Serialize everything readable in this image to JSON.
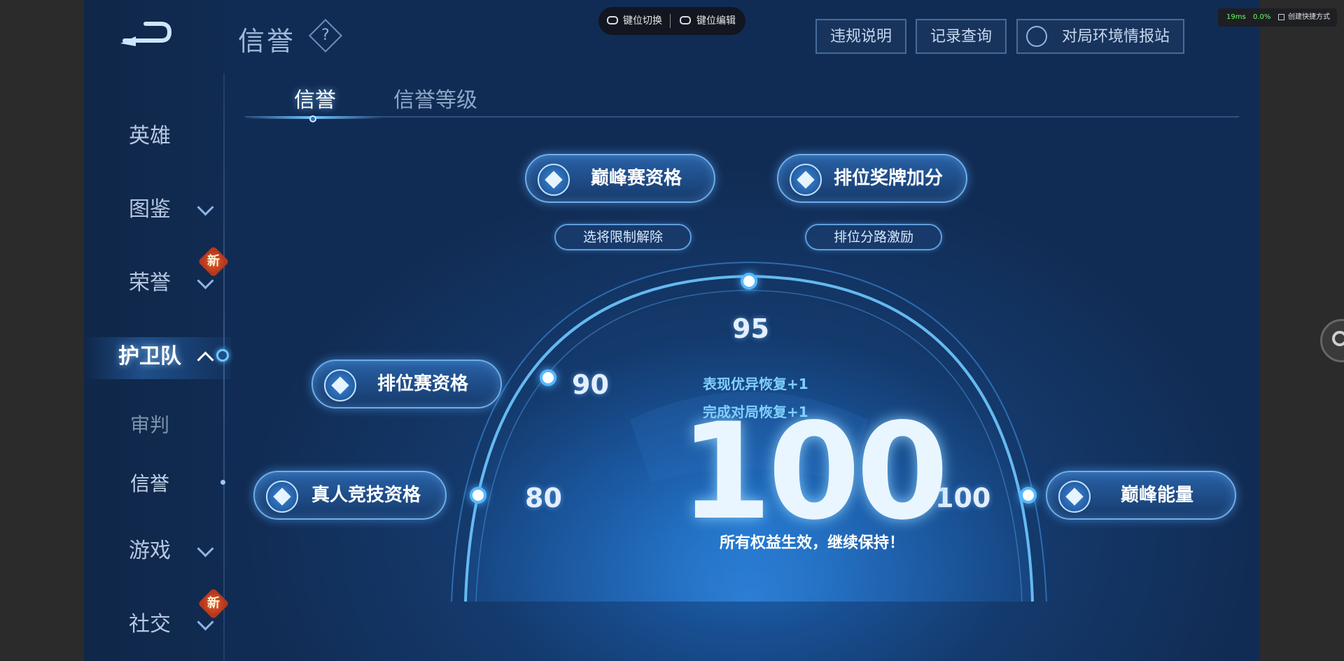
{
  "keybar": {
    "switch_label": "键位切换",
    "edit_label": "键位编辑"
  },
  "overlay": {
    "latency": "19ms",
    "loss": "0.0%",
    "shortcut": "创建快捷方式"
  },
  "header": {
    "title": "信誉",
    "help": "?",
    "buttons": [
      "违规说明",
      "记录查询",
      "对局环境情报站"
    ]
  },
  "tabs": [
    "信誉",
    "信誉等级"
  ],
  "sidebar": {
    "items": [
      {
        "label": "英雄"
      },
      {
        "label": "图鉴"
      },
      {
        "label": "荣誉",
        "badge": "新"
      },
      {
        "label": "护卫队"
      },
      {
        "label": "审判"
      },
      {
        "label": "信誉"
      },
      {
        "label": "游戏"
      },
      {
        "label": "社交",
        "badge": "新"
      }
    ]
  },
  "privileges": {
    "peak_qualification": "巅峰赛资格",
    "rank_medal_bonus": "排位奖牌加分",
    "hero_limit_lift": "选将限制解除",
    "rank_lane_incentive": "排位分路激励",
    "ranked_qualification": "排位赛资格",
    "real_competitive_qualification": "真人竞技资格",
    "peak_energy": "巅峰能量"
  },
  "thresholds": {
    "t80": "80",
    "t90": "90",
    "t95": "95",
    "t100": "100"
  },
  "score": {
    "value": "100",
    "recover_performance": "表现优异恢复+1",
    "recover_match": "完成对局恢复+1",
    "status": "所有权益生效，继续保持！"
  },
  "colors": {
    "accent": "#55b8ff",
    "badge": "#c8441f",
    "background": "#143a6d"
  }
}
